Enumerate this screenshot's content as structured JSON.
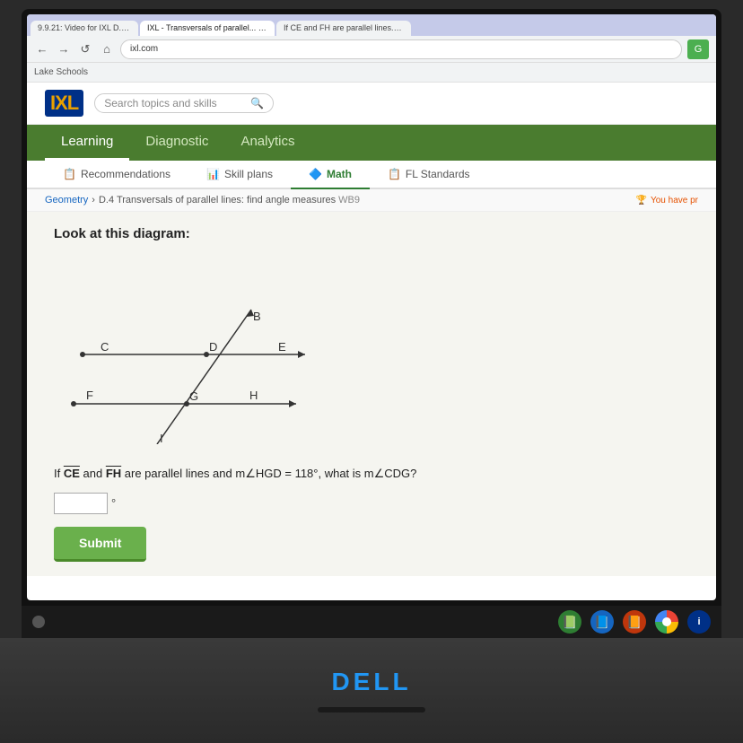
{
  "browser": {
    "tabs": [
      {
        "label": "9.9.21: Video for IXL D.4",
        "active": false
      },
      {
        "label": "IXL - Transversals of parallel...",
        "active": true
      },
      {
        "label": "If CE and FH are parallel lines...",
        "active": false
      }
    ],
    "url": "ixl.com",
    "bookmark": "Lake Schools"
  },
  "ixl": {
    "logo": "IXL",
    "search_placeholder": "Search topics and skills",
    "nav": [
      {
        "label": "Learning",
        "active": true
      },
      {
        "label": "Diagnostic",
        "active": false
      },
      {
        "label": "Analytics",
        "active": false
      }
    ],
    "subtabs": [
      {
        "label": "Recommendations",
        "icon": "📋",
        "active": false
      },
      {
        "label": "Skill plans",
        "icon": "📊",
        "active": false
      },
      {
        "label": "Math",
        "icon": "🔷",
        "active": true
      },
      {
        "label": "FL Standards",
        "icon": "📋",
        "active": false
      }
    ],
    "breadcrumb": {
      "subject": "Geometry",
      "skill_code": "D.4",
      "skill_name": "Transversals of parallel lines: find angle measures",
      "lesson_id": "WB9"
    },
    "achievement": "You have pr",
    "problem": {
      "instruction": "Look at this diagram:",
      "question": "If CE and FH are parallel lines and m∠HGD = 118°, what is m∠CDG?",
      "answer_placeholder": "",
      "degree": "°",
      "submit_label": "Submit"
    },
    "diagram": {
      "points": [
        "B",
        "C",
        "D",
        "E",
        "F",
        "G",
        "H",
        "I"
      ]
    }
  },
  "taskbar": {
    "icons": [
      "📗",
      "📘",
      "📙",
      "🌐",
      "📕"
    ]
  },
  "dell_logo": "DELL"
}
